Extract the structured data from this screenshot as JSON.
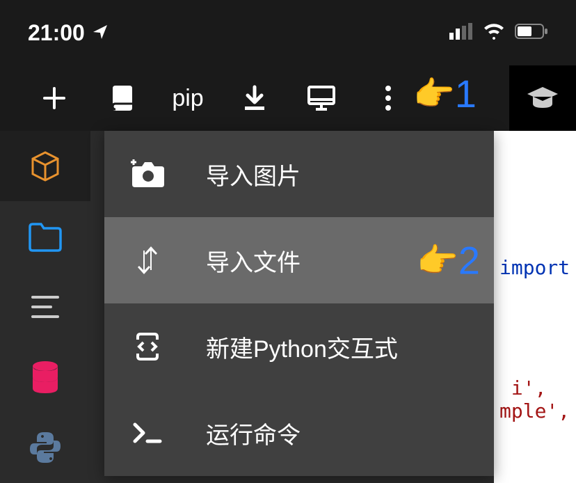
{
  "status": {
    "time": "21:00"
  },
  "toolbar": {
    "pip_label": "pip"
  },
  "menu": {
    "items": [
      {
        "label": "导入图片"
      },
      {
        "label": "导入文件"
      },
      {
        "label": "新建Python交互式"
      },
      {
        "label": "运行命令"
      }
    ]
  },
  "code": {
    "import_keyword": "import",
    "string_fragment_1": "i',",
    "string_fragment_2": "mple',"
  },
  "annotations": {
    "pointer_1": "👉",
    "number_1": "1",
    "pointer_2": "👉",
    "number_2": "2"
  }
}
